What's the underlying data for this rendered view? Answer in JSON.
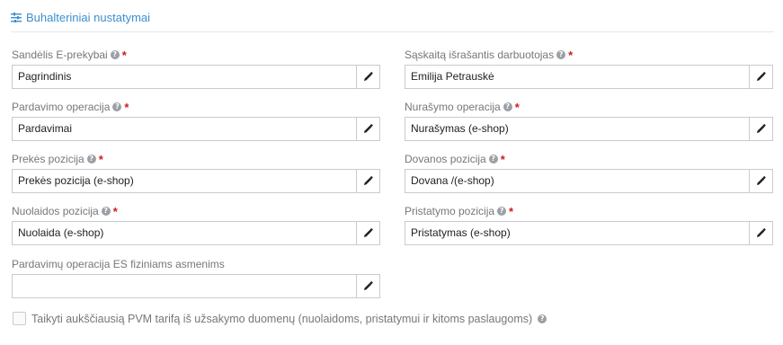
{
  "section": {
    "title": "Buhalteriniai nustatymai",
    "icon": "sliders-icon",
    "accent": "#3d8ecf"
  },
  "fields": {
    "warehouse": {
      "label": "Sandėlis E-prekybai",
      "value": "Pagrindinis",
      "required": "*"
    },
    "invoice_employee": {
      "label": "Sąskaitą išrašantis darbuotojas",
      "value": "Emilija Petrauskė",
      "required": "*"
    },
    "sales_operation": {
      "label": "Pardavimo operacija",
      "value": "Pardavimai",
      "required": "*"
    },
    "writeoff_operation": {
      "label": "Nurašymo operacija",
      "value": "Nurašymas (e-shop)",
      "required": "*"
    },
    "product_position": {
      "label": "Prekės pozicija",
      "value": "Prekės pozicija (e-shop)",
      "required": "*"
    },
    "gift_position": {
      "label": "Dovanos pozicija",
      "value": "Dovana /(e-shop)",
      "required": "*"
    },
    "discount_position": {
      "label": "Nuolaidos pozicija",
      "value": "Nuolaida (e-shop)",
      "required": "*"
    },
    "shipping_position": {
      "label": "Pristatymo pozicija",
      "value": "Pristatymas (e-shop)",
      "required": "*"
    },
    "eu_sales_operation": {
      "label": "Pardavimų operacija ES fiziniams asmenims",
      "value": ""
    }
  },
  "checkbox": {
    "label": "Taikyti aukščiausią PVM tarifą iš užsakymo duomenų (nuolaidoms, pristatymui ir kitoms paslaugoms)",
    "checked": false
  },
  "icons": {
    "help": "?",
    "edit": "pencil-icon"
  },
  "colors": {
    "required": "#d11a1a",
    "border": "#c7cbd1"
  }
}
